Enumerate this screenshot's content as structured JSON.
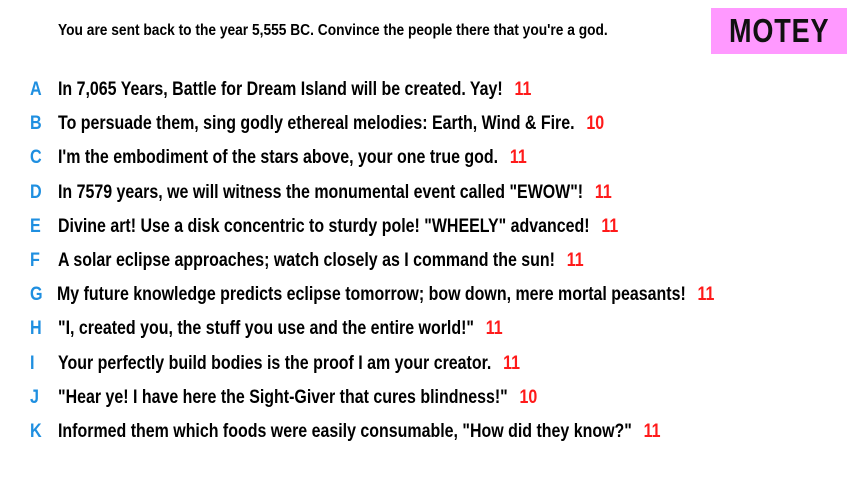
{
  "prompt": "You are sent back to the year 5,555 BC. Convince the people there that you're a god.",
  "title": "MOTEY",
  "colors": {
    "title_background": "#ff99ff",
    "letter": "#1f8fe0",
    "score": "#ff1a1a"
  },
  "answers": [
    {
      "letter": "A",
      "text": "In 7,065 Years, Battle for Dream Island will be created. Yay!",
      "score": "11"
    },
    {
      "letter": "B",
      "text": "To persuade them, sing godly ethereal melodies: Earth, Wind & Fire.",
      "score": "10"
    },
    {
      "letter": "C",
      "text": "I'm the embodiment of the stars above, your one true god.",
      "score": "11"
    },
    {
      "letter": "D",
      "text": "In 7579 years, we will witness the monumental event called \"EWOW\"!",
      "score": "11"
    },
    {
      "letter": "E",
      "text": "Divine art! Use a disk concentric to sturdy pole! \"WHEELY\" advanced!",
      "score": "11"
    },
    {
      "letter": "F",
      "text": "A solar eclipse approaches; watch closely as I command the sun!",
      "score": "11"
    },
    {
      "letter": "G",
      "text": "My future knowledge predicts eclipse tomorrow; bow down, mere mortal peasants!",
      "score": "11"
    },
    {
      "letter": "H",
      "text": "\"I, created you, the stuff you use and the entire world!\"",
      "score": "11"
    },
    {
      "letter": "I",
      "text": "Your perfectly build bodies is the proof I am your creator.",
      "score": "11"
    },
    {
      "letter": "J",
      "text": "\"Hear ye! I have here the Sight-Giver that cures blindness!\"",
      "score": "10"
    },
    {
      "letter": "K",
      "text": "Informed them which foods were easily consumable, \"How did they know?\"",
      "score": "11"
    }
  ]
}
